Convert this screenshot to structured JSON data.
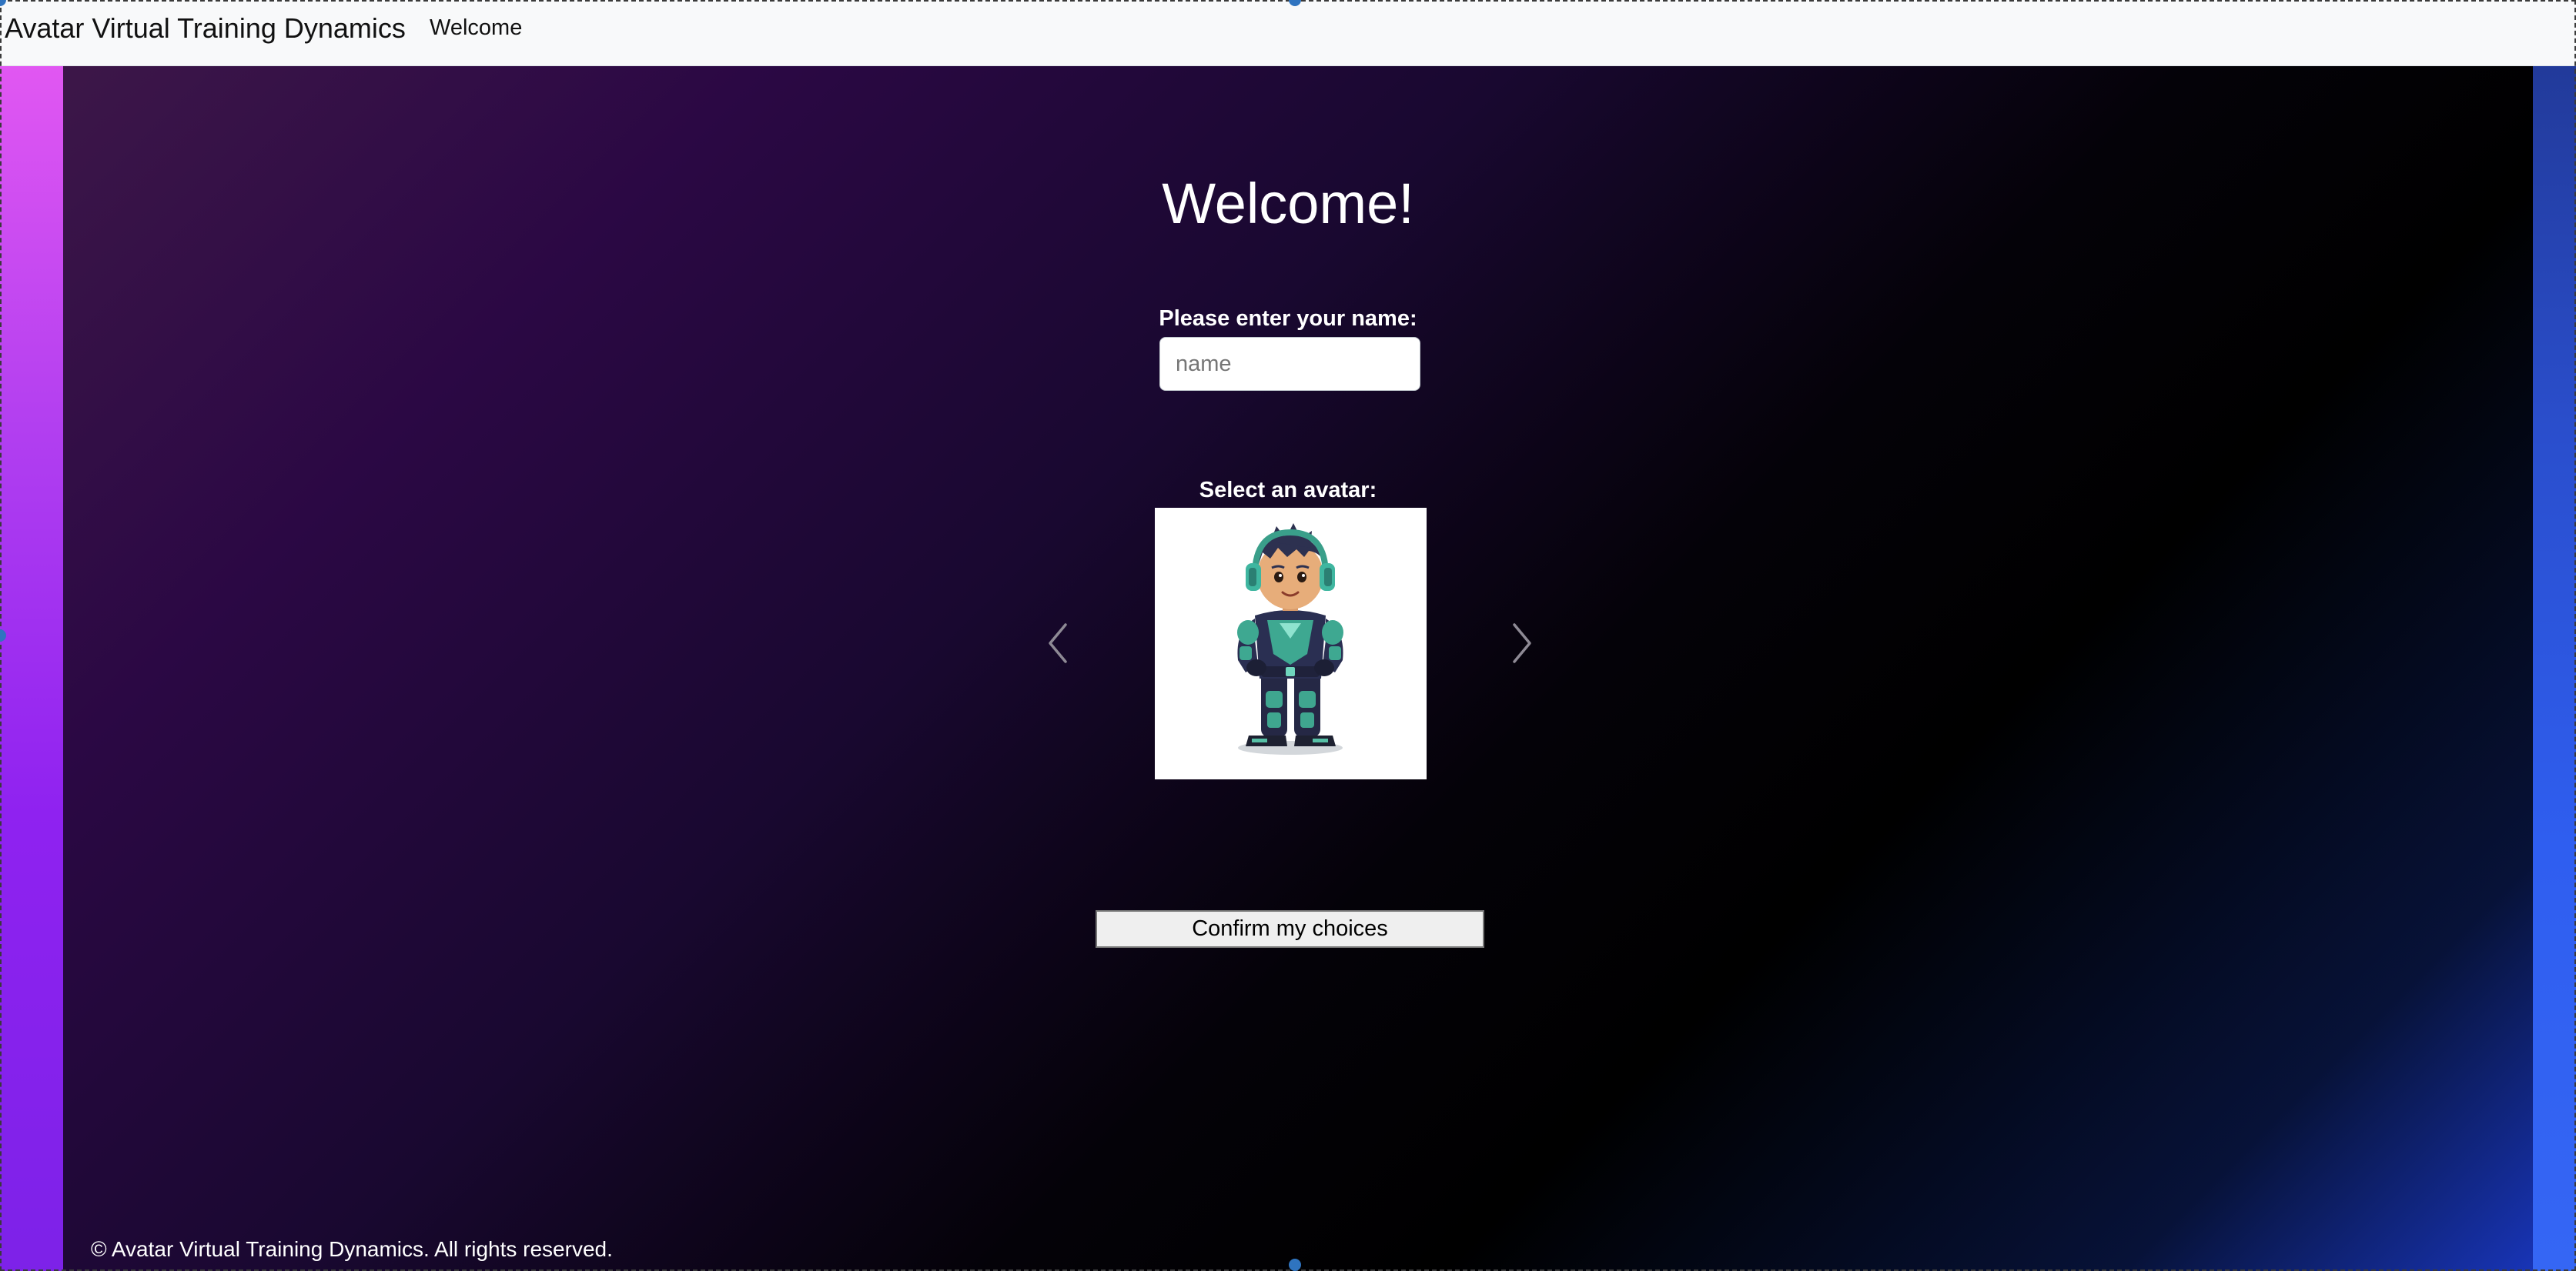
{
  "navbar": {
    "brand": "Avatar Virtual Training Dynamics",
    "link": "Welcome"
  },
  "main": {
    "title": "Welcome!",
    "name_label": "Please enter your name:",
    "name_input": {
      "value": "",
      "placeholder": "name"
    },
    "avatar_label": "Select an avatar:",
    "avatar_image": "cartoon-boy-avatar-with-headphones",
    "prev_icon": "chevron-left-icon",
    "next_icon": "chevron-right-icon",
    "confirm_label": "Confirm my choices"
  },
  "footer": {
    "text": "© Avatar Virtual Training Dynamics. All rights reserved."
  },
  "colors": {
    "navbar_bg": "#f8f9fa",
    "gradient_start": "#3e1849",
    "gradient_mid": "#000000",
    "gradient_end": "#1a38c4",
    "left_strip": "#b23ff0",
    "right_strip": "#2f5ef0"
  }
}
